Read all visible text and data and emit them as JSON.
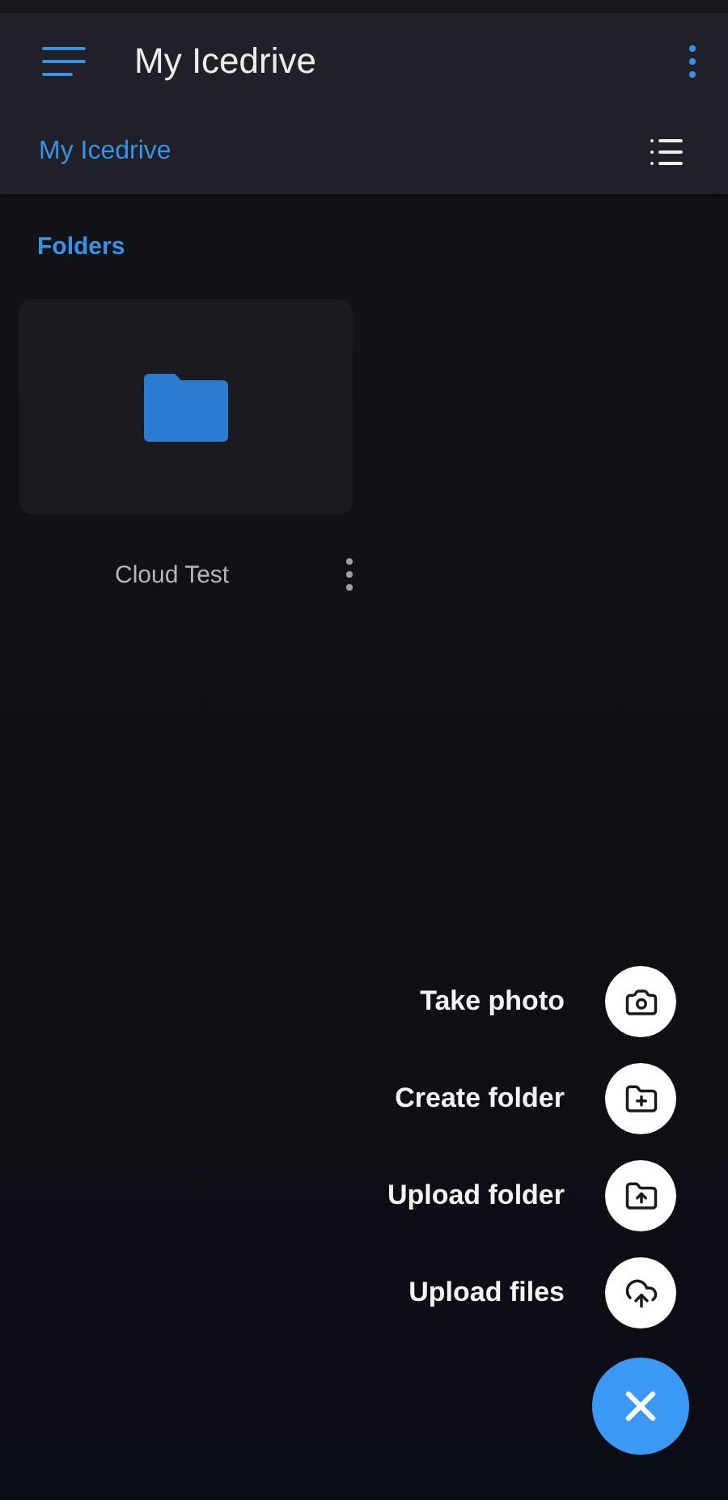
{
  "app_bar": {
    "title": "My Icedrive"
  },
  "breadcrumb": {
    "label": "My Icedrive"
  },
  "sections": [
    {
      "title": "Folders",
      "folders": [
        {
          "name": "Cloud Test"
        }
      ]
    }
  ],
  "speed_dial": {
    "open": true,
    "actions": [
      {
        "label": "Take photo",
        "kind": "camera"
      },
      {
        "label": "Create folder",
        "kind": "folder-plus"
      },
      {
        "label": "Upload folder",
        "kind": "folder-upload"
      },
      {
        "label": "Upload files",
        "kind": "cloud-upload"
      }
    ]
  }
}
